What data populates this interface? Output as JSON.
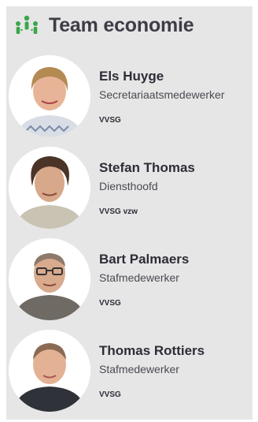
{
  "header": {
    "title": "Team economie",
    "icon": "team-icon",
    "icon_color": "#3aa64a"
  },
  "members": [
    {
      "name": "Els Huyge",
      "role": "Secretariaatsmedewerker",
      "org": "VVSG"
    },
    {
      "name": "Stefan Thomas",
      "role": "Diensthoofd",
      "org": "VVSG vzw"
    },
    {
      "name": "Bart Palmaers",
      "role": "Stafmedewerker",
      "org": "VVSG"
    },
    {
      "name": "Thomas Rottiers",
      "role": "Stafmedewerker",
      "org": "VVSG"
    }
  ]
}
